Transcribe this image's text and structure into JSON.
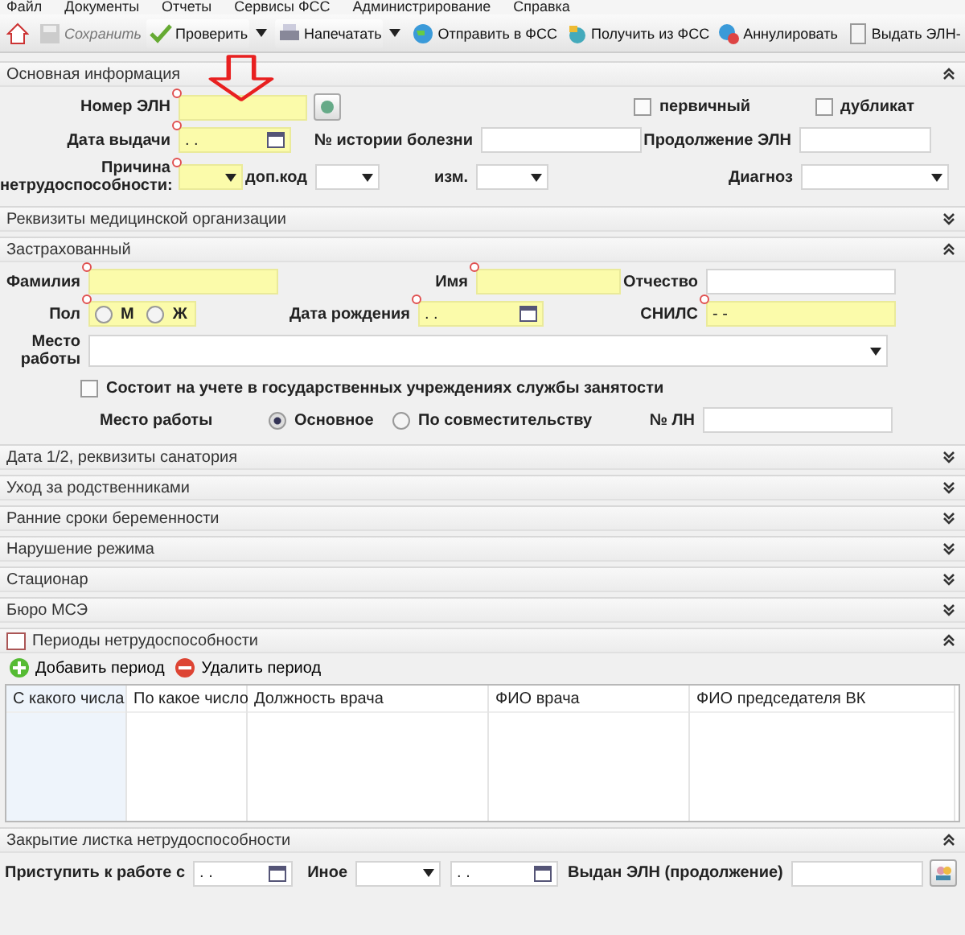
{
  "menu": [
    "Файл",
    "Документы",
    "Отчеты",
    "Сервисы ФСС",
    "Администрирование",
    "Справка"
  ],
  "toolbar": [
    {
      "kind": "home",
      "disabled": false
    },
    {
      "kind": "save",
      "label": "Сохранить",
      "disabled": true,
      "dropdown": false
    },
    {
      "kind": "check",
      "label": "Проверить",
      "disabled": false,
      "dropdown": true
    },
    {
      "kind": "print",
      "label": "Напечатать",
      "disabled": false,
      "dropdown": true
    },
    {
      "kind": "send",
      "label": "Отправить в ФСС",
      "disabled": false,
      "dropdown": false
    },
    {
      "kind": "receive",
      "label": "Получить из ФСС",
      "disabled": false,
      "dropdown": false
    },
    {
      "kind": "cancel",
      "label": "Аннулировать",
      "disabled": false,
      "dropdown": false
    },
    {
      "kind": "issue",
      "label": "Выдать ЭЛН-",
      "disabled": false,
      "dropdown": false
    }
  ],
  "sections": [
    {
      "kind": "main",
      "title": "Основная информация",
      "expanded": true,
      "eln": {
        "label": "Номер ЭЛН",
        "required": true
      },
      "primary": {
        "label": "первичный",
        "checked": false
      },
      "duplicate": {
        "label": "дубликат",
        "checked": false
      },
      "issue_date": {
        "label": "Дата выдачи",
        "value": ". .",
        "required": true
      },
      "history": {
        "label": "№ истории болезни"
      },
      "continuation": {
        "label": "Продолжение ЭЛН"
      },
      "reason": {
        "label": "Причина нетрудоспособности:",
        "required": true
      },
      "extra_code": {
        "label": "доп.код"
      },
      "change": {
        "label": "изм."
      },
      "diagnosis": {
        "label": "Диагноз"
      }
    },
    {
      "kind": "plain",
      "title": "Реквизиты медицинской организации",
      "expanded": false
    },
    {
      "kind": "insured",
      "title": "Застрахованный",
      "expanded": true,
      "surname": {
        "label": "Фамилия",
        "required": true
      },
      "name": {
        "label": "Имя",
        "required": true
      },
      "patronymic": {
        "label": "Отчество"
      },
      "sex": {
        "label": "Пол",
        "required": true,
        "options": [
          {
            "label": "М",
            "selected": false
          },
          {
            "label": "Ж",
            "selected": false
          }
        ]
      },
      "birth_date": {
        "label": "Дата рождения",
        "value": ". .",
        "required": true
      },
      "snils": {
        "label": "СНИЛС",
        "value": "-  -",
        "required": true
      },
      "workplace": {
        "label": "Место работы"
      },
      "employment": {
        "label": "Состоит на учете в государственных учреждениях службы занятости",
        "checked": false
      },
      "work_type": {
        "label": "Место работы",
        "options": [
          {
            "label": "Основное",
            "selected": true
          },
          {
            "label": "По совместительству",
            "selected": false
          }
        ]
      },
      "ln_number": {
        "label": "№ ЛН"
      }
    },
    {
      "kind": "plain",
      "title": "Дата 1/2, реквизиты санатория",
      "expanded": false
    },
    {
      "kind": "plain",
      "title": "Уход за родственниками",
      "expanded": false
    },
    {
      "kind": "plain",
      "title": "Ранние сроки беременности",
      "expanded": false
    },
    {
      "kind": "plain",
      "title": "Нарушение режима",
      "expanded": false
    },
    {
      "kind": "plain",
      "title": "Стационар",
      "expanded": false
    },
    {
      "kind": "plain",
      "title": "Бюро МСЭ",
      "expanded": false
    },
    {
      "kind": "periods",
      "title": "Периоды нетрудоспособности",
      "expanded": true,
      "actions": [
        {
          "kind": "add",
          "label": "Добавить период"
        },
        {
          "kind": "remove",
          "label": "Удалить период"
        }
      ],
      "columns": [
        "С какого числа",
        "По какое число",
        "Должность врача",
        "ФИО врача",
        "ФИО председателя ВК"
      ]
    },
    {
      "kind": "closing",
      "title": "Закрытие листка нетрудоспособности",
      "expanded": true,
      "return_date": {
        "label": "Приступить к работе с",
        "value": ". ."
      },
      "other": {
        "label": "Иное"
      },
      "other_date": {
        "value": ". ."
      },
      "issued": {
        "label": "Выдан ЭЛН (продолжение)"
      }
    }
  ]
}
